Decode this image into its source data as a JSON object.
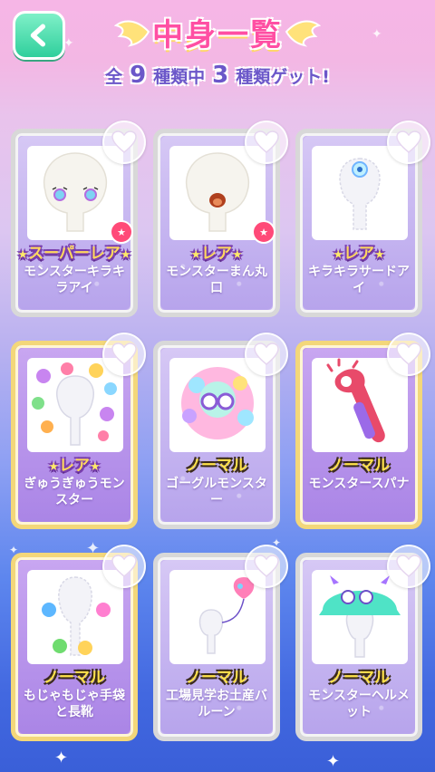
{
  "header": {
    "title": "中身一覧",
    "count_prefix": "全",
    "total": "9",
    "count_mid": "種類中",
    "owned": "3",
    "count_suffix": "種類ゲット!"
  },
  "items": [
    {
      "rarity": "スーパーレア",
      "name": "モンスターキラキラアイ",
      "new": true
    },
    {
      "rarity": "レア",
      "name": "モンスターまん丸口",
      "new": true
    },
    {
      "rarity": "レア",
      "name": "キラキラサードアイ",
      "new": false
    },
    {
      "rarity": "レア",
      "name": "ぎゅうぎゅうモンスター",
      "new": false
    },
    {
      "rarity": "ノーマル",
      "name": "ゴーグルモンスター",
      "new": false
    },
    {
      "rarity": "ノーマル",
      "name": "モンスタースパナ",
      "new": false
    },
    {
      "rarity": "ノーマル",
      "name": "もじゃもじゃ手袋と長靴",
      "new": false
    },
    {
      "rarity": "ノーマル",
      "name": "工場見学お土産バルーン",
      "new": false
    },
    {
      "rarity": "ノーマル",
      "name": "モンスターヘルメット",
      "new": false
    }
  ],
  "colors": {
    "title": "#ff4fa3",
    "count": "#6b57c9",
    "back_button": "#2fcf9c",
    "heart": "#ffffff",
    "new_badge": "#ff4a78"
  },
  "icons": {
    "back": "chevron-left-icon",
    "favorite": "heart-icon",
    "new": "star-icon"
  }
}
